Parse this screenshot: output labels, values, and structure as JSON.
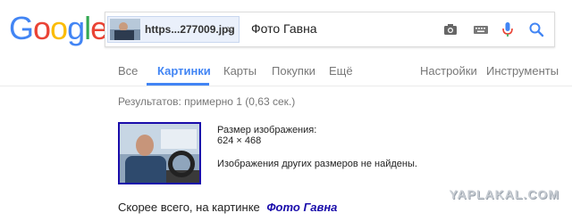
{
  "logo": {
    "letters": [
      "G",
      "o",
      "o",
      "g",
      "l",
      "e"
    ],
    "colors": [
      "#4285f4",
      "#ea4335",
      "#fbbc05",
      "#4285f4",
      "#34a853",
      "#ea4335"
    ]
  },
  "search": {
    "image_chip": {
      "filename": "https...277009.jpg",
      "close": "×"
    },
    "query": "Фото Гавна",
    "icons": [
      "camera-icon",
      "keyboard-icon",
      "microphone-icon",
      "search-icon"
    ]
  },
  "tabs": {
    "left": [
      "Все",
      "Картинки",
      "Карты",
      "Покупки",
      "Ещё"
    ],
    "active_index": 1,
    "right": [
      "Настройки",
      "Инструменты"
    ]
  },
  "results": {
    "stats": "Результатов: примерно 1 (0,63 сек.)",
    "image_size_label": "Размер изображения:",
    "image_size_value": "624 × 468",
    "no_other_sizes": "Изображения других размеров не найдены.",
    "best_guess_prefix": "Скорее всего, на картинке",
    "best_guess_link": "Фото Гавна"
  },
  "watermark": "YAPLAKAL.COM",
  "colors": {
    "accent": "#4285f4",
    "link": "#1a0dab",
    "muted": "#777777"
  }
}
